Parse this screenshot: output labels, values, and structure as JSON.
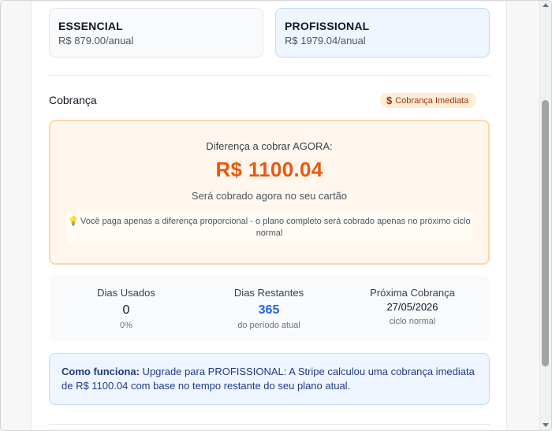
{
  "plans": {
    "current": {
      "name": "ESSENCIAL",
      "price": "R$ 879.00/anual"
    },
    "target": {
      "name": "PROFISSIONAL",
      "price": "R$ 1979.04/anual"
    }
  },
  "billing": {
    "title": "Cobrança",
    "badge_label": "Cobrança Imediata",
    "badge_icon": "dollar-icon",
    "charge_label": "Diferença a cobrar AGORA:",
    "charge_amount": "R$ 1100.04",
    "charge_sub": "Será cobrado agora no seu cartão",
    "note_icon": "lightbulb-icon",
    "note_text": "Você paga apenas a diferença proporcional - o plano completo será cobrado apenas no próximo ciclo normal"
  },
  "stats": {
    "used": {
      "label": "Dias Usados",
      "value": "0",
      "sub": "0%"
    },
    "remaining": {
      "label": "Dias Restantes",
      "value": "365",
      "sub": "do período atual"
    },
    "next": {
      "label": "Próxima Cobrança",
      "value": "27/05/2026",
      "sub": "ciclo normal"
    }
  },
  "info": {
    "strong": "Como funciona:",
    "text": " Upgrade para PROFISSIONAL: A Stripe calculou uma cobrança imediata de R$ 1100.04 com base no tempo restante do seu plano atual."
  },
  "colors": {
    "accent_orange": "#ea580c",
    "accent_blue": "#2563eb",
    "info_blue_text": "#1e3a8a"
  }
}
